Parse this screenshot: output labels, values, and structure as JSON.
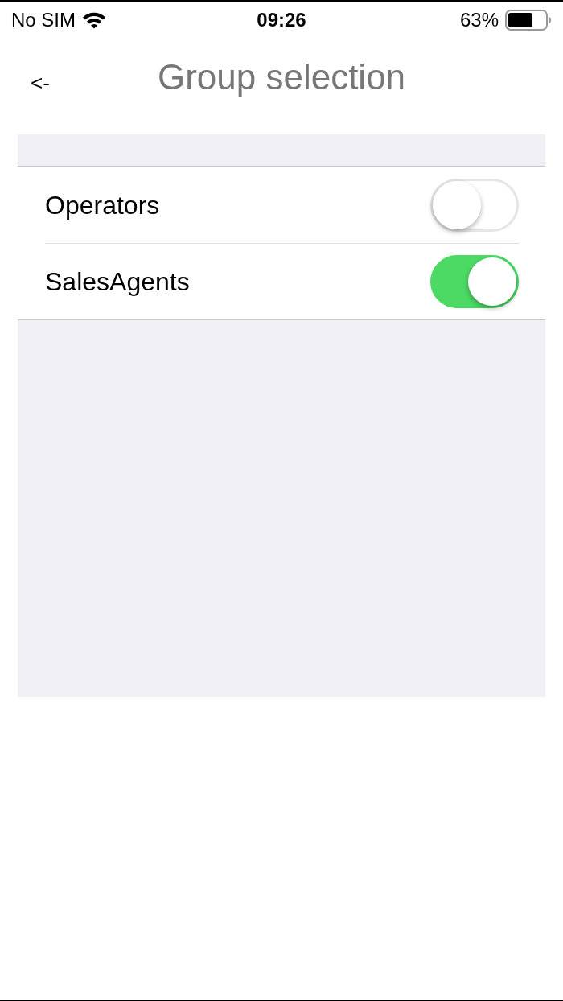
{
  "status_bar": {
    "carrier": "No SIM",
    "time": "09:26",
    "battery": "63%"
  },
  "nav": {
    "back": "<-",
    "title": "Group selection"
  },
  "groups": [
    {
      "label": "Operators",
      "on": false
    },
    {
      "label": "SalesAgents",
      "on": true
    }
  ]
}
